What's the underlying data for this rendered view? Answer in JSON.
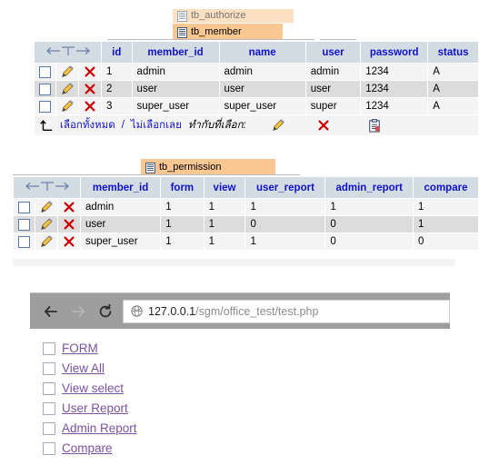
{
  "phpmyadmin": {
    "tabs": {
      "clipped_above": "tb_authorize",
      "member_tab": "tb_member",
      "permission_tab": "tb_permission"
    },
    "member_table": {
      "sort_icon_label": "←T→",
      "headers": [
        "id",
        "member_id",
        "name",
        "user",
        "password",
        "status"
      ],
      "rows": [
        {
          "id": "1",
          "member_id": "admin",
          "name": "admin",
          "user": "admin",
          "password": "1234",
          "status": "A"
        },
        {
          "id": "2",
          "member_id": "user",
          "name": "user",
          "user": "user",
          "password": "1234",
          "status": "A"
        },
        {
          "id": "3",
          "member_id": "super_user",
          "name": "super_user",
          "user": "super",
          "password": "1234",
          "status": "A"
        }
      ],
      "footer": {
        "select_all": "เลือกทั้งหมด",
        "separator": "/",
        "select_none": "ไม่เลือกเลย",
        "with_selected": "ทำกับที่เลือก:"
      }
    },
    "permission_table": {
      "sort_icon_label": "←T→",
      "headers": [
        "member_id",
        "form",
        "view",
        "user_report",
        "admin_report",
        "compare"
      ],
      "rows": [
        {
          "member_id": "admin",
          "form": "1",
          "view": "1",
          "user_report": "1",
          "admin_report": "1",
          "compare": "1"
        },
        {
          "member_id": "user",
          "form": "1",
          "view": "1",
          "user_report": "0",
          "admin_report": "0",
          "compare": "1"
        },
        {
          "member_id": "super_user",
          "form": "1",
          "view": "1",
          "user_report": "1",
          "admin_report": "0",
          "compare": "0"
        }
      ]
    },
    "colors": {
      "header_bg": "#d3dce3",
      "header_text": "#1111cc",
      "active_tab_bg": "#f8c792",
      "row_odd": "#f4f4f4",
      "row_even": "#dcdcdc"
    }
  },
  "browser": {
    "url_host": "127.0.0.1",
    "url_path": "/sgm/office_test/test.php",
    "back_label": "←",
    "forward_label": "→",
    "reload_label": "⟳",
    "links": [
      {
        "label": "FORM"
      },
      {
        "label": "View All"
      },
      {
        "label": "View select"
      },
      {
        "label": "User Report"
      },
      {
        "label": "Admin Report"
      },
      {
        "label": "Compare"
      }
    ],
    "link_color": "#7a52a0"
  }
}
